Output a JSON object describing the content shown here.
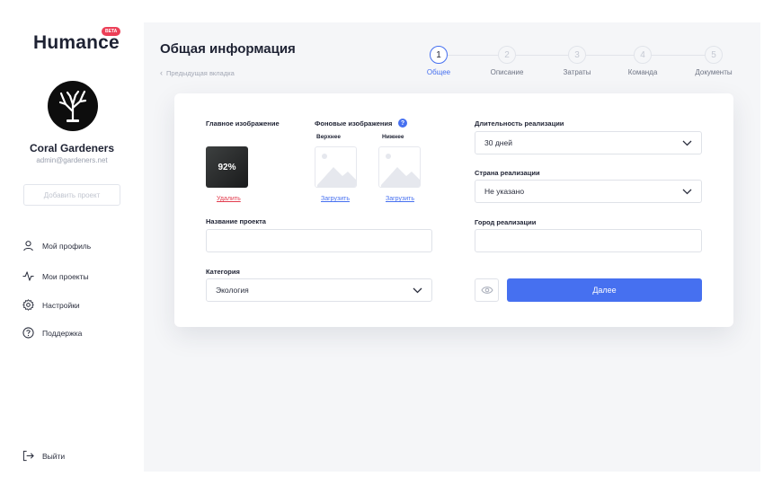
{
  "brand": {
    "name": "Humance",
    "badge": "BETA"
  },
  "user": {
    "name": "Coral Gardeners",
    "email": "admin@gardeners.net"
  },
  "sidebar": {
    "add_project": "Добавить проект",
    "items": [
      {
        "label": "Мой профиль",
        "icon": "user-icon"
      },
      {
        "label": "Мои проекты",
        "icon": "activity-icon"
      },
      {
        "label": "Настройки",
        "icon": "gear-icon"
      },
      {
        "label": "Поддержка",
        "icon": "help-circle-icon"
      }
    ],
    "logout": "Выйти"
  },
  "header": {
    "title": "Общая информация",
    "prev_tab": "Предыдущая вкладка"
  },
  "steps": [
    {
      "num": "1",
      "label": "Общее",
      "active": true
    },
    {
      "num": "2",
      "label": "Описание",
      "active": false
    },
    {
      "num": "3",
      "label": "Затраты",
      "active": false
    },
    {
      "num": "4",
      "label": "Команда",
      "active": false
    },
    {
      "num": "5",
      "label": "Документы",
      "active": false
    }
  ],
  "form": {
    "main_image_label": "Главное изображение",
    "main_image_progress": "92%",
    "delete_link": "Удалить",
    "bg_images_label": "Фоновые изображения",
    "help_mark": "?",
    "bg_top_label": "Верхнее",
    "bg_bottom_label": "Нижнее",
    "upload_link": "Загрузить",
    "project_name_label": "Название проекта",
    "project_name_value": "",
    "category_label": "Категория",
    "category_value": "Экология",
    "duration_label": "Длительность реализации",
    "duration_value": "30 дней",
    "country_label": "Страна реализации",
    "country_value": "Не указано",
    "city_label": "Город реализации",
    "city_value": "",
    "next_button": "Далее"
  },
  "colors": {
    "accent": "#4670f0",
    "danger": "#e23b4d",
    "badge": "#ec3f57"
  }
}
